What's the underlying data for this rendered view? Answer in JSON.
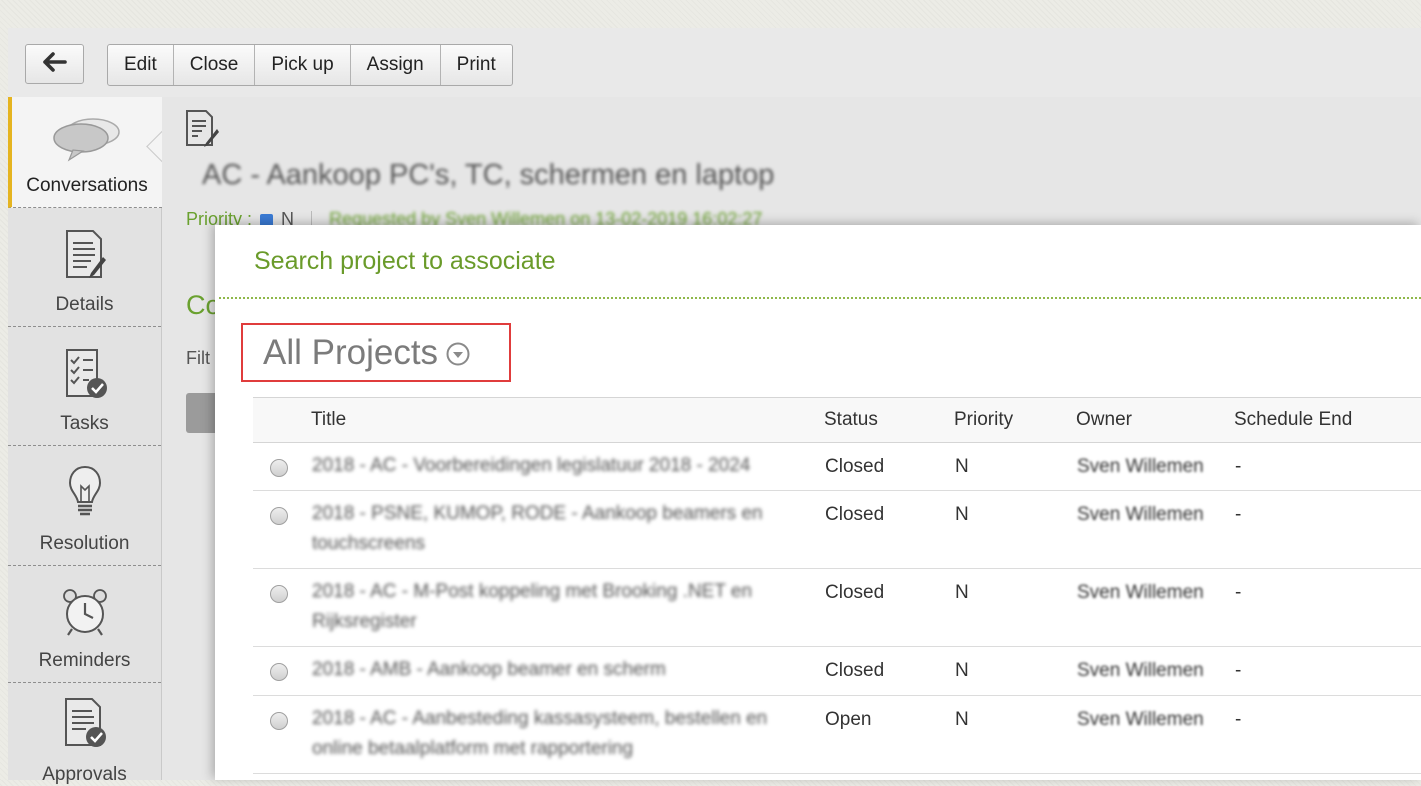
{
  "toolbar": {
    "back_icon": "arrow-left-icon",
    "buttons": [
      "Edit",
      "Close",
      "Pick up",
      "Assign",
      "Print"
    ]
  },
  "sidebar": {
    "items": [
      {
        "label": "Conversations",
        "icon": "chat-bubbles-icon",
        "active": true
      },
      {
        "label": "Details",
        "icon": "document-edit-icon"
      },
      {
        "label": "Tasks",
        "icon": "checklist-icon"
      },
      {
        "label": "Resolution",
        "icon": "lightbulb-icon"
      },
      {
        "label": "Reminders",
        "icon": "alarm-clock-icon"
      },
      {
        "label": "Approvals",
        "icon": "approval-document-icon"
      }
    ]
  },
  "ticket": {
    "title": "AC - Aankoop PC's, TC, schermen en laptop",
    "priority_label": "Priority :",
    "priority_value": "N",
    "requested": "Requested by Sven Willemen on 13-02-2019 16:02:27",
    "section_heading": "Co",
    "filter_label": "Filt"
  },
  "modal": {
    "title": "Search project to associate",
    "filter": "All Projects",
    "columns": [
      "Title",
      "Status",
      "Priority",
      "Owner",
      "Schedule End"
    ],
    "rows": [
      {
        "title": "2018 - AC - Voorbereidingen legislatuur 2018 - 2024",
        "status": "Closed",
        "priority": "N",
        "owner": "Sven Willemen",
        "end": "-"
      },
      {
        "title": "2018 - PSNE, KUMOP, RODE - Aankoop beamers en touchscreens",
        "status": "Closed",
        "priority": "N",
        "owner": "Sven Willemen",
        "end": "-"
      },
      {
        "title": "2018 - AC - M-Post koppeling met Brooking .NET en Rijksregister",
        "status": "Closed",
        "priority": "N",
        "owner": "Sven Willemen",
        "end": "-"
      },
      {
        "title": "2018 - AMB - Aankoop beamer en scherm",
        "status": "Closed",
        "priority": "N",
        "owner": "Sven Willemen",
        "end": "-"
      },
      {
        "title": "2018 - AC - Aanbesteding kassasysteem, bestellen en online betaalplatform met rapportering",
        "status": "Open",
        "priority": "N",
        "owner": "Sven Willemen",
        "end": "-"
      }
    ]
  },
  "colors": {
    "accent_green": "#6aa12f",
    "highlight_red": "#e03c3c",
    "active_marker": "#e5b420"
  }
}
